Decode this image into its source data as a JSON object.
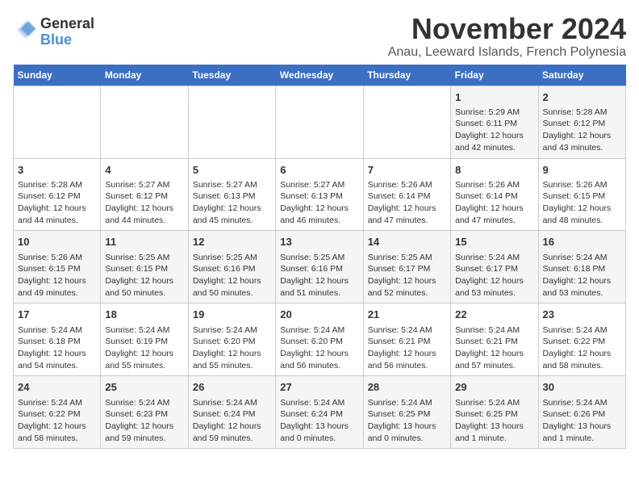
{
  "logo": {
    "line1": "General",
    "line2": "Blue"
  },
  "title": "November 2024",
  "subtitle": "Anau, Leeward Islands, French Polynesia",
  "days_of_week": [
    "Sunday",
    "Monday",
    "Tuesday",
    "Wednesday",
    "Thursday",
    "Friday",
    "Saturday"
  ],
  "weeks": [
    [
      {
        "day": "",
        "info": ""
      },
      {
        "day": "",
        "info": ""
      },
      {
        "day": "",
        "info": ""
      },
      {
        "day": "",
        "info": ""
      },
      {
        "day": "",
        "info": ""
      },
      {
        "day": "1",
        "info": "Sunrise: 5:29 AM\nSunset: 6:11 PM\nDaylight: 12 hours\nand 42 minutes."
      },
      {
        "day": "2",
        "info": "Sunrise: 5:28 AM\nSunset: 6:12 PM\nDaylight: 12 hours\nand 43 minutes."
      }
    ],
    [
      {
        "day": "3",
        "info": "Sunrise: 5:28 AM\nSunset: 6:12 PM\nDaylight: 12 hours\nand 44 minutes."
      },
      {
        "day": "4",
        "info": "Sunrise: 5:27 AM\nSunset: 6:12 PM\nDaylight: 12 hours\nand 44 minutes."
      },
      {
        "day": "5",
        "info": "Sunrise: 5:27 AM\nSunset: 6:13 PM\nDaylight: 12 hours\nand 45 minutes."
      },
      {
        "day": "6",
        "info": "Sunrise: 5:27 AM\nSunset: 6:13 PM\nDaylight: 12 hours\nand 46 minutes."
      },
      {
        "day": "7",
        "info": "Sunrise: 5:26 AM\nSunset: 6:14 PM\nDaylight: 12 hours\nand 47 minutes."
      },
      {
        "day": "8",
        "info": "Sunrise: 5:26 AM\nSunset: 6:14 PM\nDaylight: 12 hours\nand 47 minutes."
      },
      {
        "day": "9",
        "info": "Sunrise: 5:26 AM\nSunset: 6:15 PM\nDaylight: 12 hours\nand 48 minutes."
      }
    ],
    [
      {
        "day": "10",
        "info": "Sunrise: 5:26 AM\nSunset: 6:15 PM\nDaylight: 12 hours\nand 49 minutes."
      },
      {
        "day": "11",
        "info": "Sunrise: 5:25 AM\nSunset: 6:15 PM\nDaylight: 12 hours\nand 50 minutes."
      },
      {
        "day": "12",
        "info": "Sunrise: 5:25 AM\nSunset: 6:16 PM\nDaylight: 12 hours\nand 50 minutes."
      },
      {
        "day": "13",
        "info": "Sunrise: 5:25 AM\nSunset: 6:16 PM\nDaylight: 12 hours\nand 51 minutes."
      },
      {
        "day": "14",
        "info": "Sunrise: 5:25 AM\nSunset: 6:17 PM\nDaylight: 12 hours\nand 52 minutes."
      },
      {
        "day": "15",
        "info": "Sunrise: 5:24 AM\nSunset: 6:17 PM\nDaylight: 12 hours\nand 53 minutes."
      },
      {
        "day": "16",
        "info": "Sunrise: 5:24 AM\nSunset: 6:18 PM\nDaylight: 12 hours\nand 53 minutes."
      }
    ],
    [
      {
        "day": "17",
        "info": "Sunrise: 5:24 AM\nSunset: 6:18 PM\nDaylight: 12 hours\nand 54 minutes."
      },
      {
        "day": "18",
        "info": "Sunrise: 5:24 AM\nSunset: 6:19 PM\nDaylight: 12 hours\nand 55 minutes."
      },
      {
        "day": "19",
        "info": "Sunrise: 5:24 AM\nSunset: 6:20 PM\nDaylight: 12 hours\nand 55 minutes."
      },
      {
        "day": "20",
        "info": "Sunrise: 5:24 AM\nSunset: 6:20 PM\nDaylight: 12 hours\nand 56 minutes."
      },
      {
        "day": "21",
        "info": "Sunrise: 5:24 AM\nSunset: 6:21 PM\nDaylight: 12 hours\nand 56 minutes."
      },
      {
        "day": "22",
        "info": "Sunrise: 5:24 AM\nSunset: 6:21 PM\nDaylight: 12 hours\nand 57 minutes."
      },
      {
        "day": "23",
        "info": "Sunrise: 5:24 AM\nSunset: 6:22 PM\nDaylight: 12 hours\nand 58 minutes."
      }
    ],
    [
      {
        "day": "24",
        "info": "Sunrise: 5:24 AM\nSunset: 6:22 PM\nDaylight: 12 hours\nand 58 minutes."
      },
      {
        "day": "25",
        "info": "Sunrise: 5:24 AM\nSunset: 6:23 PM\nDaylight: 12 hours\nand 59 minutes."
      },
      {
        "day": "26",
        "info": "Sunrise: 5:24 AM\nSunset: 6:24 PM\nDaylight: 12 hours\nand 59 minutes."
      },
      {
        "day": "27",
        "info": "Sunrise: 5:24 AM\nSunset: 6:24 PM\nDaylight: 13 hours\nand 0 minutes."
      },
      {
        "day": "28",
        "info": "Sunrise: 5:24 AM\nSunset: 6:25 PM\nDaylight: 13 hours\nand 0 minutes."
      },
      {
        "day": "29",
        "info": "Sunrise: 5:24 AM\nSunset: 6:25 PM\nDaylight: 13 hours\nand 1 minute."
      },
      {
        "day": "30",
        "info": "Sunrise: 5:24 AM\nSunset: 6:26 PM\nDaylight: 13 hours\nand 1 minute."
      }
    ]
  ],
  "colors": {
    "header_bg": "#3a6fc4",
    "odd_row": "#f5f5f5",
    "even_row": "#ffffff"
  }
}
